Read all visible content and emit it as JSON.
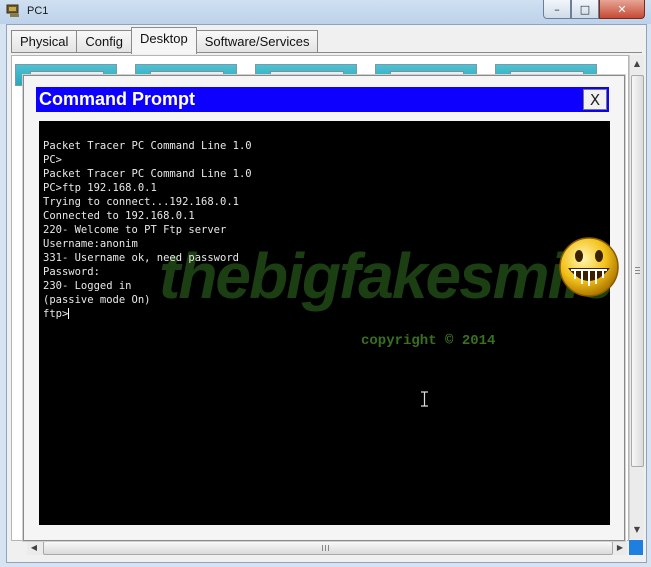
{
  "window": {
    "title": "PC1",
    "buttons": {
      "minimize": "–",
      "maximize": "□",
      "close": "✕"
    }
  },
  "tabs": [
    {
      "label": "Physical"
    },
    {
      "label": "Config"
    },
    {
      "label": "Desktop"
    },
    {
      "label": "Software/Services"
    }
  ],
  "active_tab": "Desktop",
  "command_prompt": {
    "title": "Command Prompt",
    "close_label": "X",
    "lines": [
      "Packet Tracer PC Command Line 1.0",
      "PC>",
      "Packet Tracer PC Command Line 1.0",
      "PC>ftp 192.168.0.1",
      "Trying to connect...192.168.0.1",
      "Connected to 192.168.0.1",
      "220- Welcome to PT Ftp server",
      "Username:anonim",
      "331- Username ok, need password",
      "Password:",
      "230- Logged in",
      "(passive mode On)",
      "ftp>"
    ]
  },
  "watermark": {
    "text": "thebigfakesmile",
    "copyright": "copyright © 2014"
  },
  "colors": {
    "cmd_titlebar": "#0e00ff",
    "terminal_bg": "#000000",
    "terminal_text": "#e8e8e8",
    "watermark": "#3c8c28"
  },
  "icons": {
    "app": "packet-tracer-pc-icon",
    "cursor": "ibeam-cursor-icon",
    "decor": "grinning-smiley-icon"
  }
}
